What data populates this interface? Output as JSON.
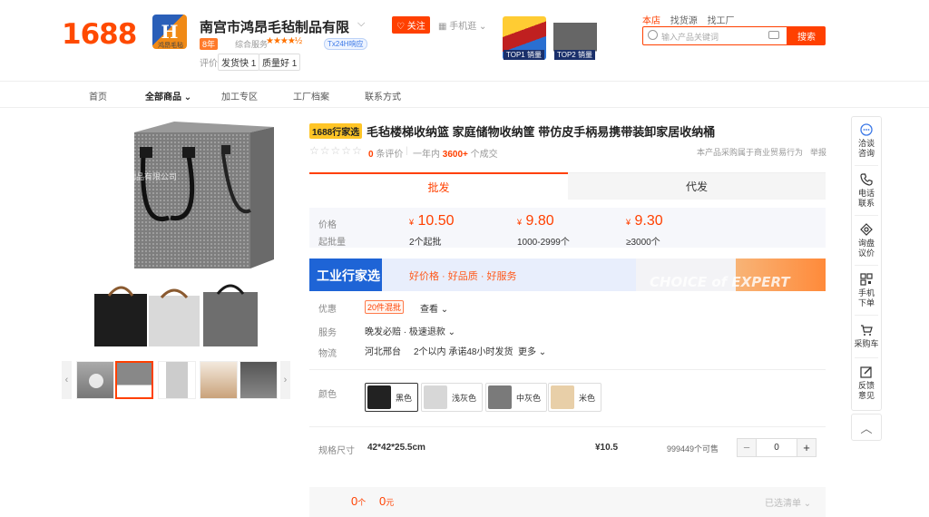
{
  "header": {
    "logo": "1688",
    "shop_logo_glyph": "H",
    "shop_logo_text": "鸿昂毛毡",
    "shop_name": "南宫市鸿昂毛毡制品有限",
    "year_badge": "8年",
    "rating_label": "综合服务",
    "rating_stars": "★★★★½",
    "tx_badge": "Tx24H响应",
    "eval_label": "评价",
    "tags": [
      "发货快 1",
      "质量好 1"
    ],
    "follow_label": "关注",
    "mobile_label": "手机逛",
    "promos": [
      "TOP1 销量",
      "TOP2 销量"
    ],
    "top_links": [
      "本店",
      "找货源",
      "找工厂"
    ],
    "search_placeholder": "输入产品关键词",
    "search_button": "搜索"
  },
  "nav": [
    "首页",
    "全部商品",
    "加工专区",
    "工厂档案",
    "联系方式"
  ],
  "product": {
    "title_tag": "1688行家选",
    "title": "毛毡楼梯收纳篮 家庭储物收纳筐 带仿皮手柄易携带装卸家居收纳桶",
    "review_stars": "☆☆☆☆☆",
    "review_count": "0",
    "review_suffix": "条评价",
    "sales_prefix": "一年内",
    "sales_count": "3600+",
    "sales_suffix": "个成交",
    "right_note": "本产品采购属于商业贸易行为",
    "report": "举报"
  },
  "tabs": [
    "批发",
    "代发"
  ],
  "pricing": {
    "price_label": "价格",
    "moq_label": "起批量",
    "tiers": [
      {
        "price": "10.50",
        "moq": "2个起批"
      },
      {
        "price": "9.80",
        "moq": "1000-2999个"
      },
      {
        "price": "9.30",
        "moq": "≥3000个"
      }
    ],
    "currency": "¥"
  },
  "banner": {
    "title": "工业行家选",
    "slogan": "好价格 · 好品质 · 好服务",
    "english": "CHOICE of EXPERT"
  },
  "service": {
    "discount_label": "优惠",
    "discount_badge": "20件混批",
    "discount_link": "查看",
    "service_label": "服务",
    "service_value": "晚发必赔 · 极速退款",
    "logistics_label": "物流",
    "origin": "河北邢台",
    "shipping": "2个以内 承诺48小时发货",
    "more": "更多"
  },
  "colors": {
    "label": "颜色",
    "options": [
      {
        "name": "黑色",
        "swatch": "#222222"
      },
      {
        "name": "浅灰色",
        "swatch": "#d7d7d7"
      },
      {
        "name": "中灰色",
        "swatch": "#7a7a7a"
      },
      {
        "name": "米色",
        "swatch": "#e8cfa8"
      }
    ]
  },
  "spec": {
    "label": "规格尺寸",
    "value": "42*42*25.5cm",
    "price": "¥10.5",
    "stock": "999449个可售",
    "quantity": "0"
  },
  "footer_bar": {
    "count": "0",
    "count_unit": "个",
    "amount": "0",
    "amount_unit": "元",
    "selected_list": "已选清单"
  },
  "right_toolbar": [
    {
      "label": "洽谈\n咨询",
      "icon": "chat-icon"
    },
    {
      "label": "电话\n联系",
      "icon": "phone-icon"
    },
    {
      "label": "询盘\n议价",
      "icon": "inquiry-icon"
    },
    {
      "label": "手机\n下单",
      "icon": "qrcode-icon"
    },
    {
      "label": "采购车",
      "icon": "cart-icon"
    },
    {
      "label": "反馈\n意见",
      "icon": "feedback-icon"
    }
  ],
  "watermark": "南宫市鸿昂毛毡制品有限公司",
  "accent_color": "#ff4000"
}
